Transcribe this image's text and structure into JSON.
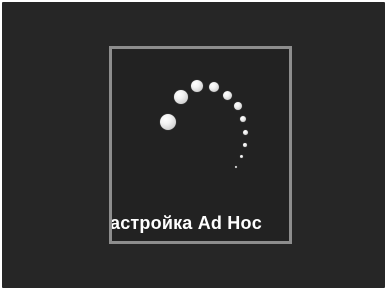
{
  "dialog": {
    "status_text": "астройка Ad Hoc"
  },
  "spinner": {
    "icon": "loading-spinner-icon",
    "dot_color": "#ffffff"
  },
  "colors": {
    "screen_background": "#262626",
    "dialog_border": "#8d8d8d"
  }
}
